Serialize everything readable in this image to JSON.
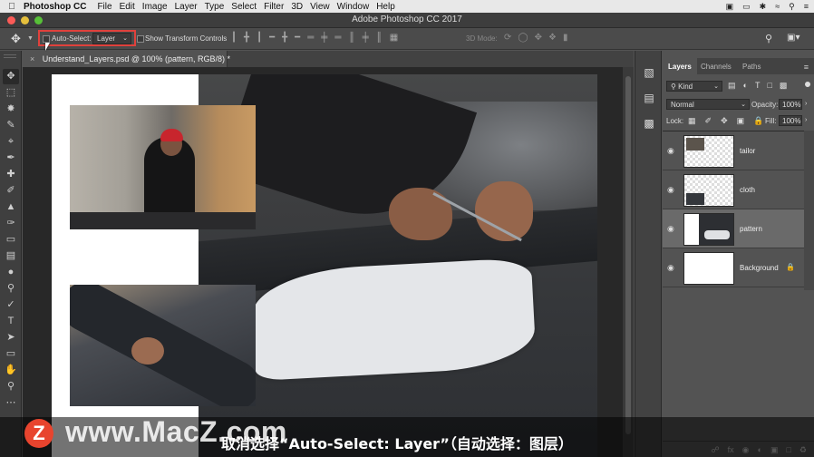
{
  "menubar": {
    "app_name": "Photoshop CC",
    "items": [
      "File",
      "Edit",
      "Image",
      "Layer",
      "Type",
      "Select",
      "Filter",
      "3D",
      "View",
      "Window",
      "Help"
    ]
  },
  "window": {
    "title": "Adobe Photoshop CC 2017",
    "traffic_colors": [
      "#fc5b57",
      "#e5bf3c",
      "#57c038"
    ]
  },
  "options_bar": {
    "auto_select_label": "Auto-Select:",
    "auto_select_checked": false,
    "auto_select_target": "Layer",
    "show_transform_label": "Show Transform Controls",
    "mode_3d_label": "3D Mode:",
    "highlight_color": "#e0413c"
  },
  "document": {
    "tab_label": "Understand_Layers.psd @ 100% (pattern, RGB/8) *"
  },
  "layers_panel": {
    "tabs": [
      "Layers",
      "Channels",
      "Paths"
    ],
    "active_tab": "Layers",
    "filter_kind": "Kind",
    "blend_mode": "Normal",
    "opacity_label": "Opacity:",
    "opacity": "100%",
    "lock_label": "Lock:",
    "fill_label": "Fill:",
    "fill": "100%",
    "layers": [
      {
        "name": "tailor",
        "visible": true,
        "selected": false,
        "locked": false
      },
      {
        "name": "cloth",
        "visible": true,
        "selected": false,
        "locked": false
      },
      {
        "name": "pattern",
        "visible": true,
        "selected": true,
        "locked": false
      },
      {
        "name": "Background",
        "visible": true,
        "selected": false,
        "locked": true
      }
    ]
  },
  "overlay": {
    "watermark": "www.MacZ.com",
    "watermark_logo": "Z",
    "subtitle": "取消选择“Auto-Select: Layer”（自动选择：图层）"
  }
}
